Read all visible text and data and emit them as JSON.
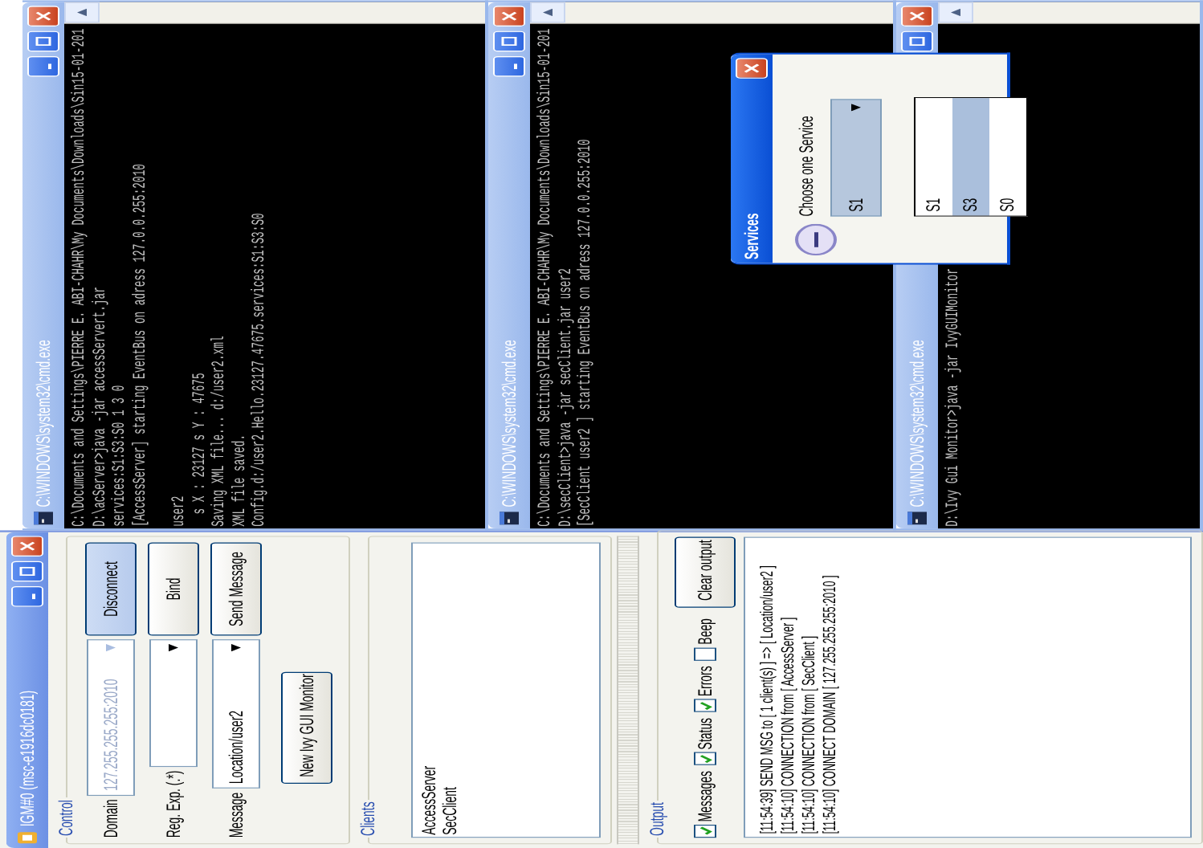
{
  "monitor_window": {
    "title": "IGM#0 (msc-e1916dc0181)",
    "control": {
      "label": "Control",
      "rows": [
        {
          "label": "Domain",
          "value": "127.255.255.255:2010",
          "disabled": true,
          "button": "Disconnect",
          "pressed": true
        },
        {
          "label": "Reg. Exp. (.*)",
          "disabled": false,
          "button": "Bind",
          "pressed": false
        },
        {
          "label": "Message",
          "value": "Location/user2",
          "disabled": false,
          "button": "Send Message",
          "pressed": false
        }
      ],
      "new_monitor_button": "New Ivy GUI Monitor"
    },
    "clients": {
      "label": "Clients",
      "items": [
        "AccessServer",
        "SecClient"
      ]
    },
    "output": {
      "label": "Output",
      "filters": [
        {
          "label": "Messages",
          "checked": true
        },
        {
          "label": "Status",
          "checked": true
        },
        {
          "label": "Errors",
          "checked": true
        },
        {
          "label": "Beep",
          "checked": false
        }
      ],
      "clear_button": "Clear output",
      "lines": [
        "[11:54:39] SEND MSG to [ 1 client(s) ] => [ Location/user2 ]",
        "[11:54:10] CONNECTION from [ AccessServer ]",
        "[11:54:10] CONNECTION from [ SecClient ]",
        "[11:54:10] CONNECT DOMAIN [ 127.255.255.255:2010 ]"
      ]
    }
  },
  "consoles": [
    {
      "title": "C:\\WINDOWS\\system32\\cmd.exe",
      "blocks": [
        [
          "C:\\Documents and Settings\\PIERRE E. ABI-CHAHR\\My Documents\\Downloads\\Sin15-01-201",
          "D:\\acServer>java -jar accessServert.jar",
          "services:S1:S3:S0 1 3 0",
          "[AccessServer] starting EventBus on adress 127.0.0.255:2010"
        ],
        [
          "user2",
          "  s X : 23127 s Y : 47675",
          "Saving XML file... d:/user2.xml",
          "XML file saved.",
          "Config.d:/user2.Hello.23127.47675.services:S1:S3:S0"
        ]
      ]
    },
    {
      "title": "C:\\WINDOWS\\system32\\cmd.exe",
      "blocks": [
        [
          "C:\\Documents and Settings\\PIERRE E. ABI-CHAHR\\My Documents\\Downloads\\Sin15-01-201",
          "D:\\secClient>java -jar secClient.jar user2",
          "[SecClient user2 ] starting EventBus on adress 127.0.0.255:2010"
        ]
      ]
    },
    {
      "title": "C:\\WINDOWS\\system32\\cmd.exe",
      "blocks": [
        [
          "D:\\Ivy Gui Monitor>java -jar IvyGUIMonitor"
        ]
      ]
    }
  ],
  "services_dialog": {
    "title": "Services",
    "prompt": "Choose one Service",
    "value": "S1",
    "options": [
      {
        "label": "S1",
        "highlighted": false
      },
      {
        "label": "S3",
        "highlighted": true
      },
      {
        "label": "S0",
        "highlighted": false
      }
    ]
  }
}
